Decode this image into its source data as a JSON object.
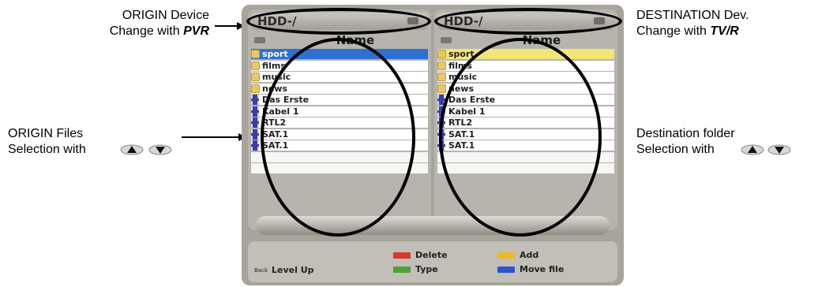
{
  "annotations": {
    "origin_device": {
      "line1": "ORIGIN Device",
      "line2_prefix": "Change with ",
      "line2_key": "PVR"
    },
    "destination_device": {
      "line1": "DESTINATION Dev.",
      "line2_prefix": "Change with ",
      "line2_key": "TV/R"
    },
    "origin_files": {
      "line1": "ORIGIN Files",
      "line2": "Selection with"
    },
    "destination_folder": {
      "line1": "Destination folder",
      "line2": "Selection with"
    },
    "nav_icons": [
      "up-arrow-icon",
      "down-arrow-icon"
    ]
  },
  "screen": {
    "left_pane": {
      "device": "HDD-/",
      "column_header": "Name",
      "rows": [
        {
          "label": "sport",
          "icon": "folder-icon",
          "state": "selected"
        },
        {
          "label": "films",
          "icon": "folder-icon",
          "state": ""
        },
        {
          "label": "music",
          "icon": "folder-icon",
          "state": ""
        },
        {
          "label": "news",
          "icon": "folder-icon",
          "state": ""
        },
        {
          "label": "Das Erste",
          "icon": "film-icon",
          "state": ""
        },
        {
          "label": "Kabel 1",
          "icon": "film-icon",
          "state": ""
        },
        {
          "label": "RTL2",
          "icon": "film-icon",
          "state": ""
        },
        {
          "label": "SAT.1",
          "icon": "film-icon",
          "state": ""
        },
        {
          "label": "SAT.1",
          "icon": "film-icon",
          "state": ""
        }
      ]
    },
    "right_pane": {
      "device": "HDD-/",
      "column_header": "Name",
      "rows": [
        {
          "label": "sport",
          "icon": "folder-icon",
          "state": "selected"
        },
        {
          "label": "films",
          "icon": "folder-icon",
          "state": ""
        },
        {
          "label": "music",
          "icon": "folder-icon",
          "state": ""
        },
        {
          "label": "news",
          "icon": "folder-icon",
          "state": ""
        },
        {
          "label": "Das Erste",
          "icon": "film-icon",
          "state": ""
        },
        {
          "label": "Kabel 1",
          "icon": "film-icon",
          "state": ""
        },
        {
          "label": "RTL2",
          "icon": "film-icon",
          "state": ""
        },
        {
          "label": "SAT.1",
          "icon": "film-icon",
          "state": ""
        },
        {
          "label": "SAT.1",
          "icon": "film-icon",
          "state": ""
        }
      ]
    },
    "footer": {
      "back_key": "Back",
      "level_up": "Level Up",
      "delete": "Delete",
      "type": "Type",
      "add": "Add",
      "move_file": "Move file"
    }
  },
  "colors": {
    "left_selection": "#2e6fd0",
    "right_selection": "#f3e678",
    "key_red": "#d63a2a",
    "key_green": "#4fa23a",
    "key_yellow": "#e8b92a",
    "key_blue": "#2a55c8"
  }
}
